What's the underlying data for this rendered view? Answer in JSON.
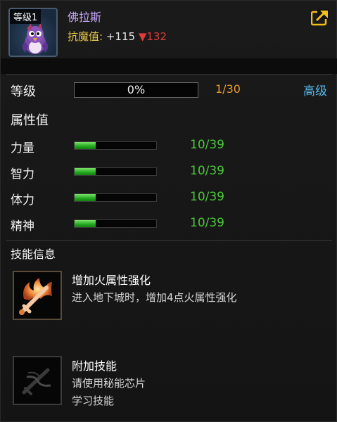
{
  "header": {
    "level_tag": "等级1",
    "pet_name": "佛拉斯",
    "resist_label": "抗魔值:",
    "resist_up": "+115",
    "resist_down_arrow": "▼",
    "resist_down": "132",
    "share_icon": "share-icon"
  },
  "level": {
    "label": "等级",
    "progress_text": "0%",
    "progress": 0,
    "count": "1/30",
    "advanced": "高级"
  },
  "attributes": {
    "title": "属性值",
    "stats": [
      {
        "label": "力量",
        "value": "10/39",
        "fraction": 0.256
      },
      {
        "label": "智力",
        "value": "10/39",
        "fraction": 0.256
      },
      {
        "label": "体力",
        "value": "10/39",
        "fraction": 0.256
      },
      {
        "label": "精神",
        "value": "10/39",
        "fraction": 0.256
      }
    ]
  },
  "skills": {
    "title": "技能信息",
    "items": [
      {
        "name": "增加火属性强化",
        "desc": [
          "进入地下城时，增加4点火属性强化"
        ],
        "icon": "fire-sword-icon"
      },
      {
        "name": "附加技能",
        "desc": [
          "请使用秘能芯片",
          "学习技能"
        ],
        "icon": "empty-skill-icon"
      }
    ]
  },
  "colors": {
    "name": "#c9a8ff",
    "resist_label": "#e6c84a",
    "resist_down": "#e03a3a",
    "level_count": "#e89a2a",
    "advanced": "#56b8e8",
    "stat_value": "#4cc83a",
    "share_icon": "#f0c018"
  }
}
